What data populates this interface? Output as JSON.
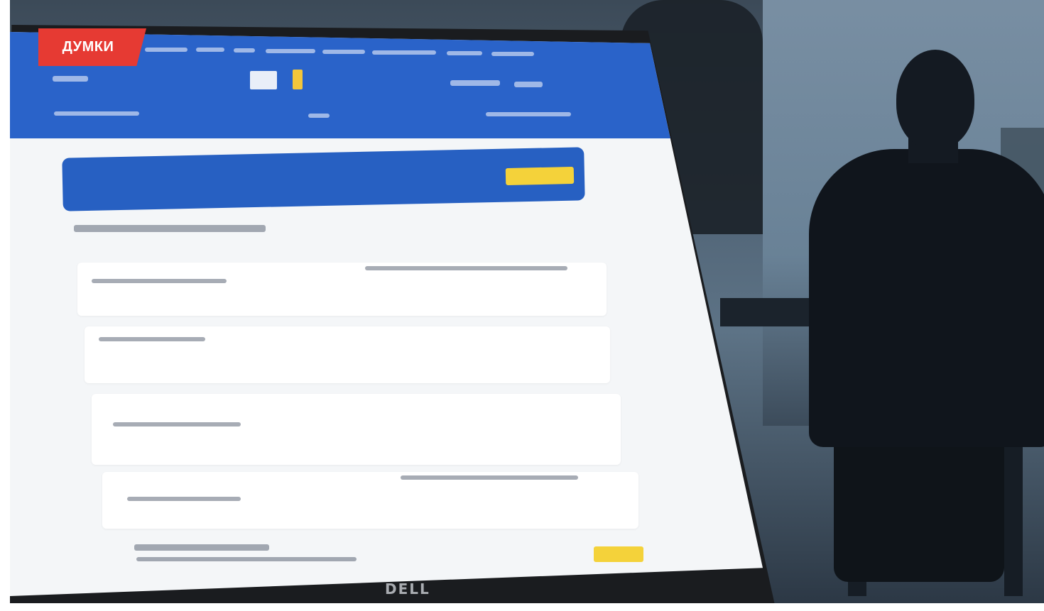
{
  "section_label": "ДУМКИ",
  "photo": {
    "laptop_brand": "DELL"
  },
  "colors": {
    "badge": "#e63a33",
    "portal_header": "#2a63c9",
    "portal_button": "#f4d23a",
    "background_dark": "#10151c"
  }
}
